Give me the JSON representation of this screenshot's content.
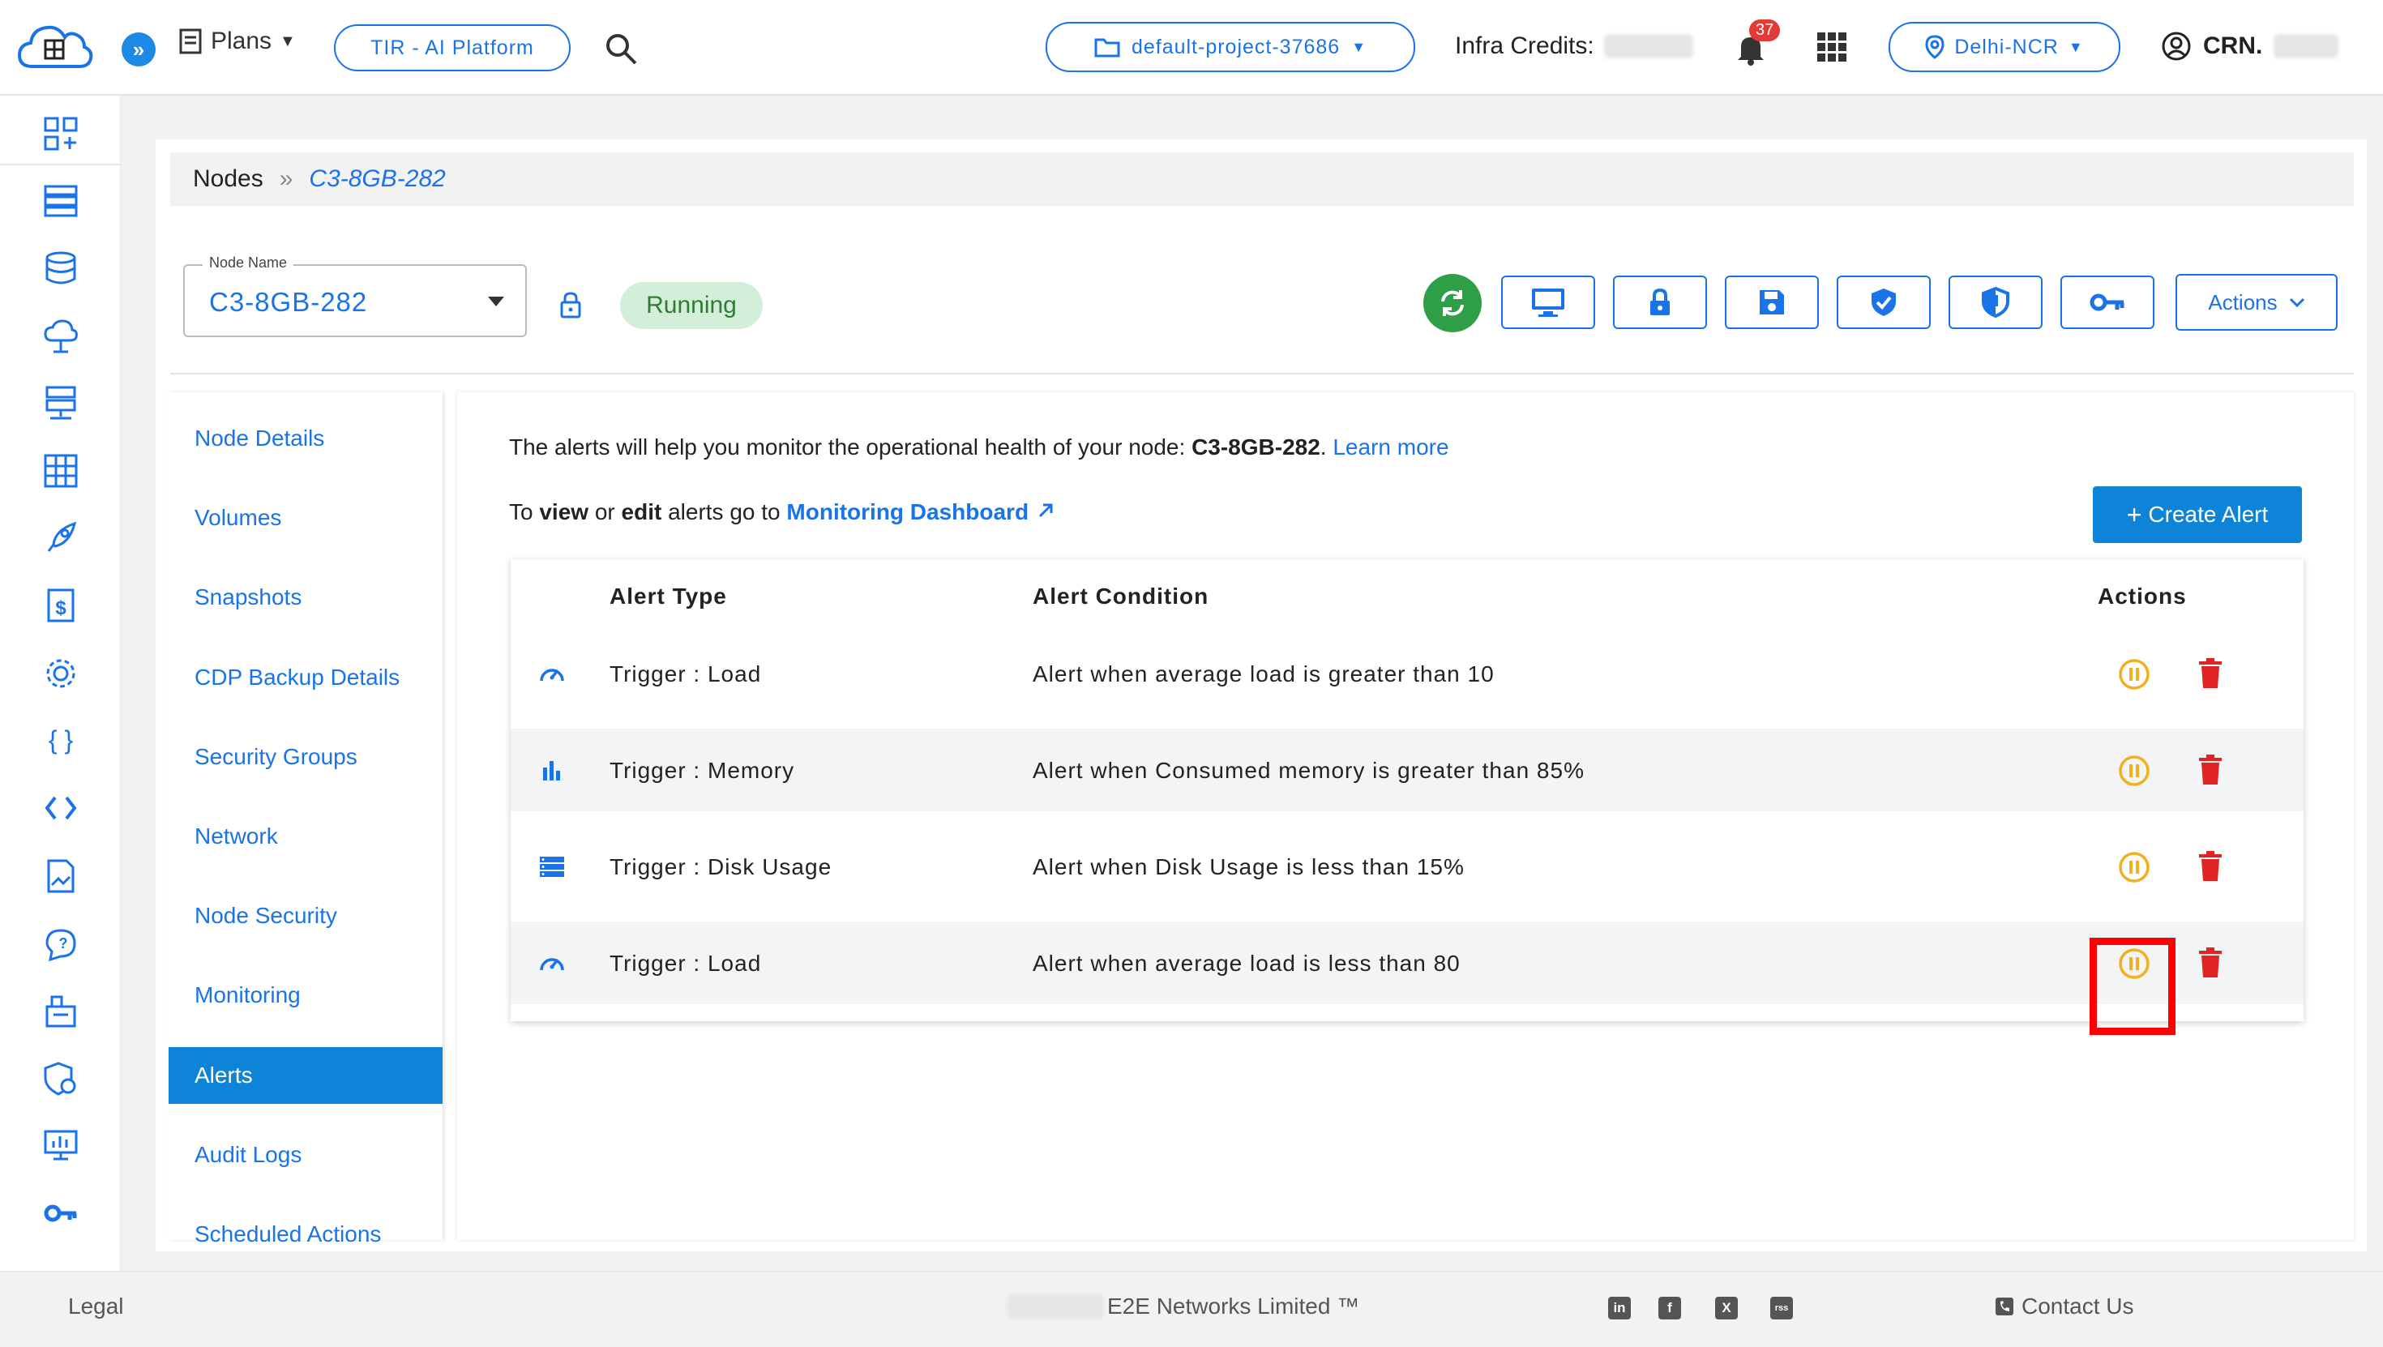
{
  "topbar": {
    "plans_label": "Plans",
    "platform_button": "TIR - AI Platform",
    "project_selector": "default-project-37686",
    "credits_label": "Infra Credits:",
    "notification_count": "37",
    "region_selector": "Delhi-NCR",
    "account_label": "CRN."
  },
  "breadcrumb": {
    "root": "Nodes",
    "separator": "»",
    "current": "C3-8GB-282"
  },
  "node": {
    "field_label": "Node Name",
    "value": "C3-8GB-282",
    "status": "Running",
    "actions_label": "Actions"
  },
  "sidenav": {
    "items": [
      {
        "label": "Node Details"
      },
      {
        "label": "Volumes"
      },
      {
        "label": "Snapshots"
      },
      {
        "label": "CDP Backup Details"
      },
      {
        "label": "Security Groups"
      },
      {
        "label": "Network"
      },
      {
        "label": "Node Security"
      },
      {
        "label": "Monitoring"
      },
      {
        "label": "Alerts"
      },
      {
        "label": "Audit Logs"
      },
      {
        "label": "Scheduled Actions"
      }
    ],
    "active": "Alerts"
  },
  "alerts": {
    "intro_prefix": "The alerts will help you monitor the operational health of your node: ",
    "intro_node": "C3-8GB-282",
    "intro_suffix": ".",
    "learn_more": "Learn more",
    "nav_to": "To ",
    "nav_view": "view",
    "nav_or": " or ",
    "nav_edit": "edit",
    "nav_rest": " alerts go to ",
    "dashboard_link": "Monitoring Dashboard",
    "create_button": "Create Alert",
    "columns": {
      "type": "Alert Type",
      "condition": "Alert Condition",
      "actions": "Actions"
    },
    "rows": [
      {
        "icon": "gauge-icon",
        "type": "Trigger : Load",
        "condition": "Alert when average load is greater than 10"
      },
      {
        "icon": "bar-chart-icon",
        "type": "Trigger : Memory",
        "condition": "Alert when Consumed memory is greater than 85%"
      },
      {
        "icon": "storage-icon",
        "type": "Trigger : Disk Usage",
        "condition": "Alert when Disk Usage is less than 15%"
      },
      {
        "icon": "gauge-icon",
        "type": "Trigger : Load",
        "condition": "Alert when average load is less than 80"
      }
    ]
  },
  "footer": {
    "legal": "Legal",
    "company": "E2E Networks Limited ™",
    "social": [
      "in",
      "f",
      "X",
      "rss"
    ],
    "contact": "Contact Us"
  },
  "colors": {
    "accent": "#1a73e8",
    "active_nav": "#0e84d8",
    "pause_icon": "#f2b01e",
    "delete_icon": "#e02424",
    "highlight": "#ff0000",
    "running_bg": "#d4efd9",
    "refresh_bg": "#2e9e47"
  }
}
